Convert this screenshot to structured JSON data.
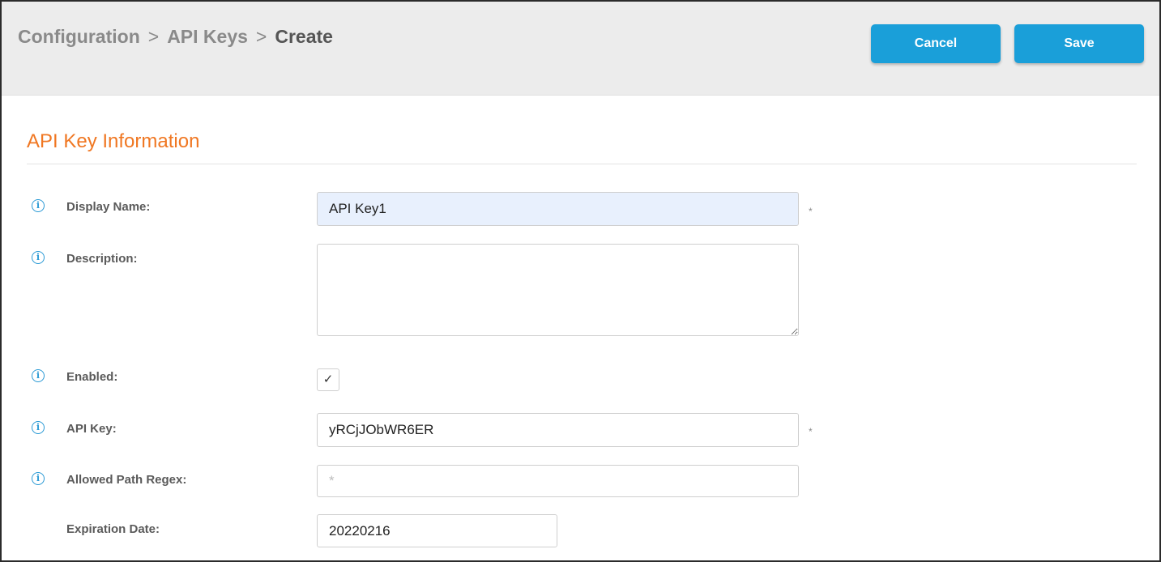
{
  "breadcrumb": {
    "items": [
      "Configuration",
      "API Keys",
      "Create"
    ],
    "separator": ">"
  },
  "toolbar": {
    "cancel_label": "Cancel",
    "save_label": "Save"
  },
  "section": {
    "title": "API Key Information"
  },
  "form": {
    "display_name": {
      "label": "Display Name:",
      "value": "API Key1",
      "required_mark": "*"
    },
    "description": {
      "label": "Description:",
      "value": ""
    },
    "enabled": {
      "label": "Enabled:",
      "checked": true,
      "check_glyph": "✓"
    },
    "api_key": {
      "label": "API Key:",
      "value": "yRCjJObWR6ER",
      "required_mark": "*"
    },
    "allowed_path_regex": {
      "label": "Allowed Path Regex:",
      "placeholder": "*"
    },
    "expiration_date": {
      "label": "Expiration Date:",
      "value": "20220216"
    }
  },
  "icons": {
    "info": "info-icon",
    "info_glyph": "i"
  },
  "colors": {
    "accent": "#1a9fd9",
    "section_title": "#f07722",
    "info_icon": "#2b9ad5"
  }
}
